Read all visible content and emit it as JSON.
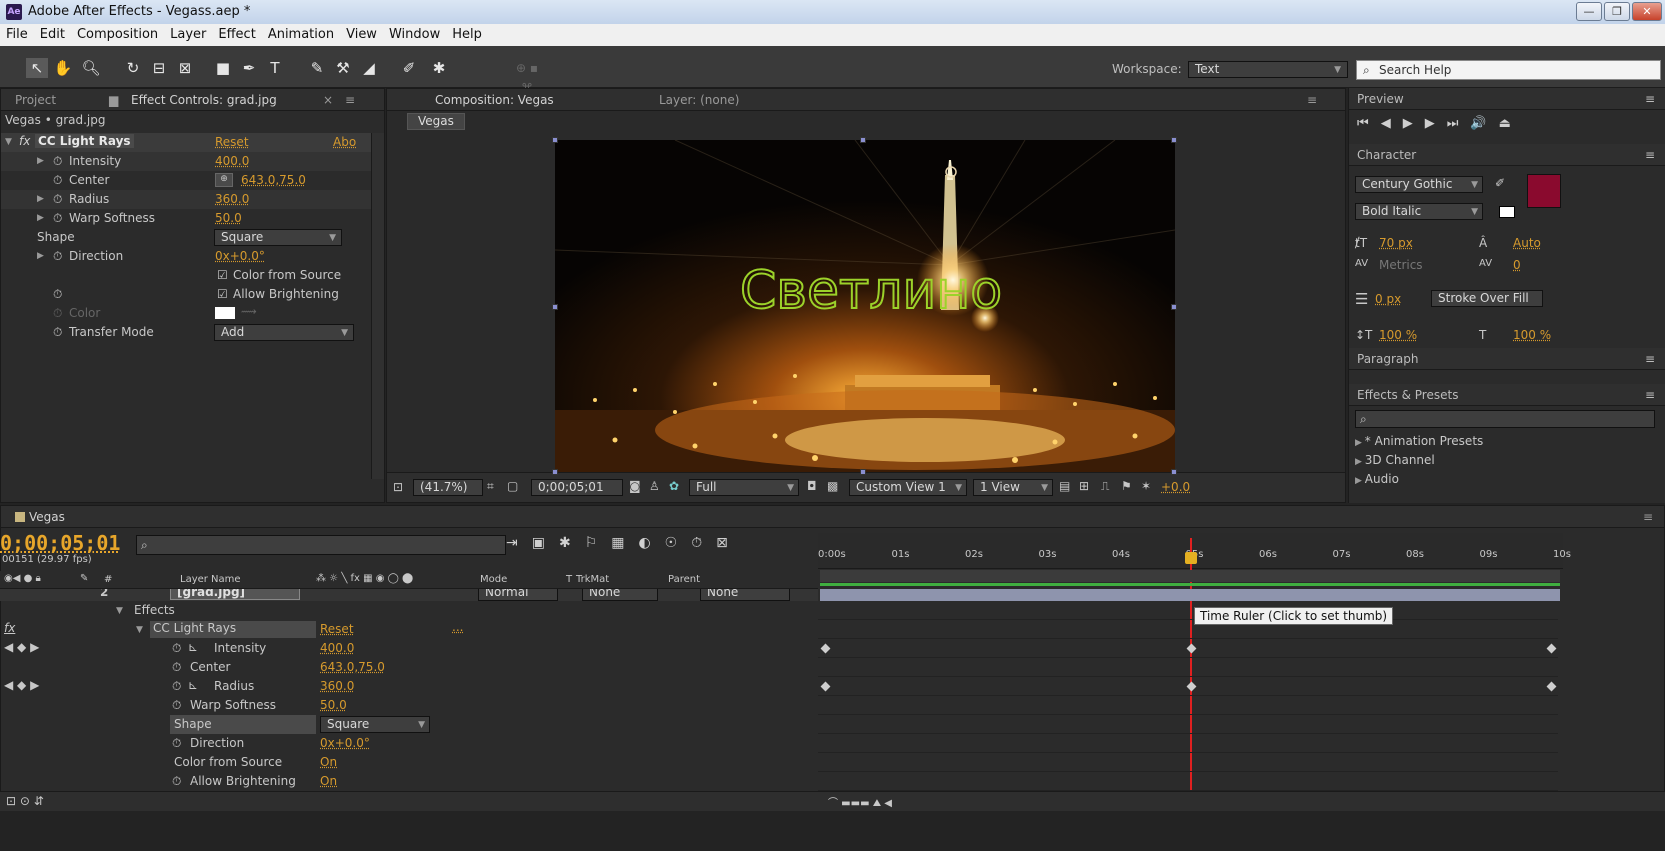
{
  "window": {
    "title": "Adobe After Effects - Vegass.aep *",
    "app_icon": "Ae"
  },
  "menu": [
    "File",
    "Edit",
    "Composition",
    "Layer",
    "Effect",
    "Animation",
    "View",
    "Window",
    "Help"
  ],
  "toolbar": {
    "workspace_label": "Workspace:",
    "workspace_value": "Text",
    "search_placeholder": "Search Help"
  },
  "effect_controls": {
    "tab_project": "Project",
    "tab_effect": "Effect Controls: grad.jpg",
    "breadcrumb": "Vegas • grad.jpg",
    "effect_name": "CC Light Rays",
    "reset": "Reset",
    "about": "Abo",
    "props": [
      {
        "name": "Intensity",
        "value": "400.0"
      },
      {
        "name": "Center",
        "value": "643.0,75.0"
      },
      {
        "name": "Radius",
        "value": "360.0"
      },
      {
        "name": "Warp Softness",
        "value": "50.0"
      },
      {
        "name": "Shape",
        "value": "Square"
      },
      {
        "name": "Direction",
        "value": "0x+0.0°"
      },
      {
        "name": "Color from Source",
        "value": "Color from Source"
      },
      {
        "name": "Allow Brightening",
        "value": "Allow Brightening"
      },
      {
        "name": "Color",
        "value": ""
      },
      {
        "name": "Transfer Mode",
        "value": "Add"
      }
    ]
  },
  "composition": {
    "tab": "Composition: Vegas",
    "layer_tab": "Layer: (none)",
    "comp_button": "Vegas",
    "overlay_text": "Светлино",
    "zoom": "(41.7%)",
    "timecode": "0;00;05;01",
    "resolution": "Full",
    "view": "Custom View 1",
    "views": "1 View",
    "exposure": "+0.0"
  },
  "right": {
    "preview_tab": "Preview",
    "character_tab": "Character",
    "font": "Century Gothic",
    "style": "Bold Italic",
    "size": "70 px",
    "leading": "Auto",
    "kerning": "Metrics",
    "tracking": "0",
    "stroke_width": "0 px",
    "stroke_mode": "Stroke Over Fill",
    "vscale": "100 %",
    "hscale": "100 %",
    "paragraph_tab": "Paragraph",
    "effects_tab": "Effects & Presets",
    "effects_list": [
      "* Animation Presets",
      "3D Channel",
      "Audio"
    ],
    "fill_color": "#8a0a2e"
  },
  "timeline": {
    "tab": "Vegas",
    "timecode": "0;00;05;01",
    "fps": "00151 (29.97 fps)",
    "columns": {
      "layer_name": "Layer Name",
      "mode": "Mode",
      "t": "T",
      "trkmat": "TrkMat",
      "parent": "Parent",
      "num": "#"
    },
    "layer": {
      "num": "2",
      "name": "[grad.jpg]",
      "mode": "Normal",
      "trkmat": "None",
      "parent": "None"
    },
    "effects_label": "Effects",
    "effect_name": "CC Light Rays",
    "reset": "Reset",
    "ellipsis": "...",
    "props": [
      {
        "name": "Intensity",
        "value": "400.0"
      },
      {
        "name": "Center",
        "value": "643.0,75.0"
      },
      {
        "name": "Radius",
        "value": "360.0"
      },
      {
        "name": "Warp Softness",
        "value": "50.0"
      },
      {
        "name": "Shape",
        "value": "Square"
      },
      {
        "name": "Direction",
        "value": "0x+0.0°"
      },
      {
        "name": "Color from Source",
        "value": "On"
      },
      {
        "name": "Allow Brightening",
        "value": "On"
      }
    ],
    "ruler": [
      "0:00s",
      "01s",
      "02s",
      "03s",
      "04s",
      "05s",
      "06s",
      "07s",
      "08s",
      "09s",
      "10s"
    ],
    "tooltip": "Time Ruler (Click to set thumb)"
  }
}
